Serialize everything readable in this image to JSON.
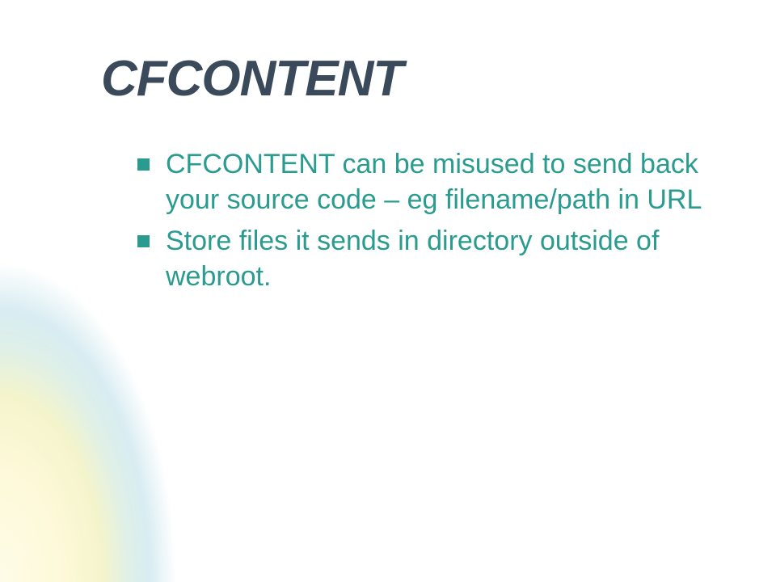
{
  "slide": {
    "title": "CFCONTENT",
    "bullets": [
      "CFCONTENT can be misused to send back your source code – eg filename/path in URL",
      "Store files it sends in directory outside of webroot."
    ]
  },
  "colors": {
    "title": "#3a4a5a",
    "bullet_text": "#2a9b8f",
    "bullet_marker": "#2a9b8f"
  }
}
